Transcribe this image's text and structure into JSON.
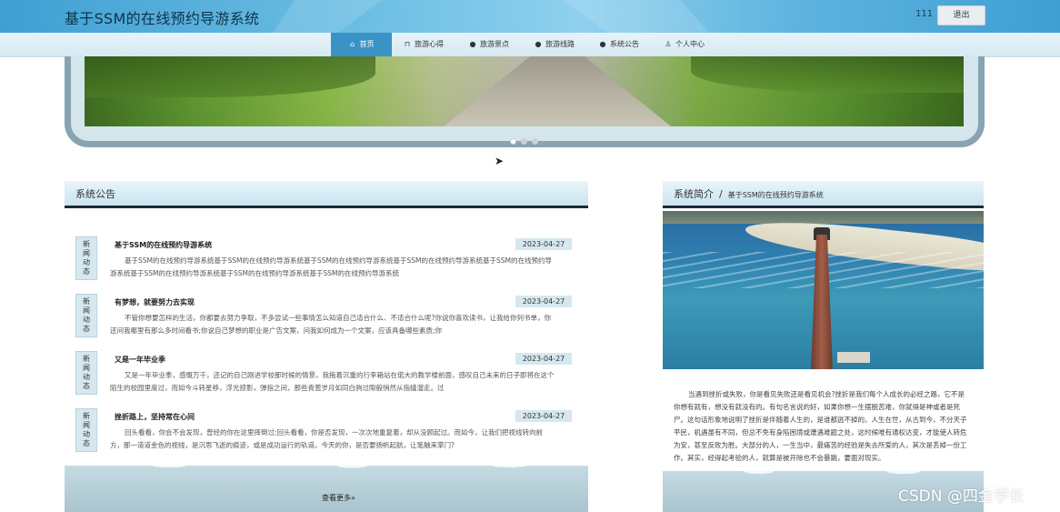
{
  "header": {
    "site_title": "基于SSM的在线预约导游系统",
    "username": "111",
    "logout_label": "退出"
  },
  "nav": {
    "items": [
      {
        "label": "首页",
        "icon": "home-icon"
      },
      {
        "label": "旅游心得",
        "icon": "bag-icon"
      },
      {
        "label": "旅游景点",
        "icon": "info-icon"
      },
      {
        "label": "旅游线路",
        "icon": "question-icon"
      },
      {
        "label": "系统公告",
        "icon": "info-icon"
      },
      {
        "label": "个人中心",
        "icon": "user-icon"
      }
    ],
    "active_index": 0
  },
  "banner": {
    "slide_count": 3,
    "active_slide": 1
  },
  "notices": {
    "section_title": "系统公告",
    "more_label": "查看更多»",
    "items": [
      {
        "tag": "新闻动态",
        "title": "基于SSM的在线预约导游系统",
        "date": "2023-04-27",
        "body": "基于SSM的在线预约导游系统基于SSM的在线预约导游系统基于SSM的在线预约导游系统基于SSM的在线预约导游系统基于SSM的在线预约导游系统基于SSM的在线预约导游系统基于SSM的在线预约导游系统基于SSM的在线预约导游系统"
      },
      {
        "tag": "新闻动态",
        "title": "有梦想，就要努力去实现",
        "date": "2023-04-27",
        "body": "不管你想要怎样的生活，你都要去努力争取，不多尝试一些事情怎么知道自己适合什么、不适合什么呢?你说你喜欢读书，让我给你列书单，你还问我哪里有那么多时间看书;你说自己梦想的职业是广告文案，问我如何成为一个文案，应该具备哪些素质;你"
      },
      {
        "tag": "新闻动态",
        "title": "又是一年毕业季",
        "date": "2023-04-27",
        "body": "又是一年毕业季，感慨万千，还记的自己刚进学校那时候的情景，我拖着沉重的行李箱站在偌大的教学楼前面，感叹自己未来的日子即将在这个陌生的校园里度过，而如今斗转星移，浮光掠影，弹指之间，那些青葱岁月如同白驹过隙般悄然从指缝溜走。过"
      },
      {
        "tag": "新闻动态",
        "title": "挫折路上，坚持常在心间",
        "date": "2023-04-27",
        "body": "回头看看，你会不会发现，曾经的你在这里摔倒过;回头看看，你是否发现，一次次地重复着，却从没顾起过。而如今，让我们把视线转向前方，那一道道金色的视线，是沉思飞逝的痕迹，或是成功运行的轨道。今天的你，是否要扬帆起航，让笔触来掌门?"
      }
    ]
  },
  "about": {
    "title": "系统简介",
    "separator": "/",
    "subtitle": "基于SSM的在线预约导游系统",
    "text": "当遇到挫折或失败，你是看见失败还是看见机会?挫折是我们每个人成长的必经之路，它不是你想有就有，想没有就没有的。有句名言说的好，如果你想一生摆脱苦难，你就得是神或者是死尸。这句话形象地说明了挫折是伴随着人生的，是谁都逃不掉的。人生在世，从古到今，不分天子平民，机遇虽有不同，但总不免有身陷困境或遭遇难题之处，这时候唯有通权达变，才能使人转危为安，甚至反败为胜。大部分的人，一生当中，最痛苦的经验是失去所爱的人，其次是丢掉一份工作。其实，经得起考验的人，就算是被开除也不会暴跳，要面对现实。"
  },
  "watermark": "CSDN @四金学长",
  "colors": {
    "accent": "#3a93c4",
    "header_bg": "#5eb4df",
    "nav_bg": "#d6e9f2",
    "section_rule": "#1b2a33"
  }
}
